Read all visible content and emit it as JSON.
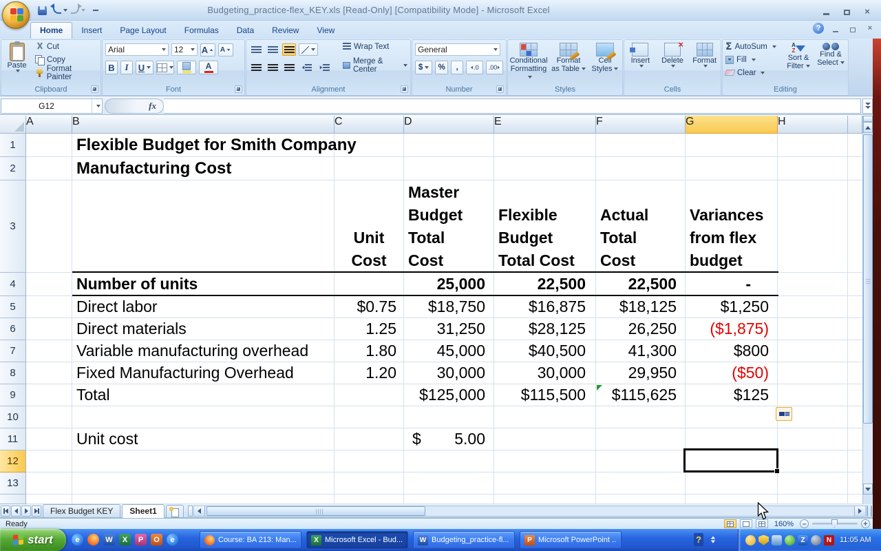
{
  "window": {
    "title": "Budgeting_practice-flex_KEY.xls  [Read-Only]  [Compatibility Mode] - Microsoft Excel",
    "close_glyph": "×",
    "help_glyph": "?"
  },
  "ribbon": {
    "tabs": [
      "Home",
      "Insert",
      "Page Layout",
      "Formulas",
      "Data",
      "Review",
      "View"
    ],
    "clipboard": {
      "label": "Clipboard",
      "paste": "Paste",
      "cut": "Cut",
      "copy": "Copy",
      "format_painter": "Format Painter"
    },
    "font": {
      "label": "Font",
      "family": "Arial",
      "size": "12",
      "bold": "B",
      "italic": "I",
      "underline": "U",
      "color_letter": "A",
      "grow_letter": "A",
      "shrink_letter": "A"
    },
    "alignment": {
      "label": "Alignment",
      "wrap_text": "Wrap Text",
      "merge_center": "Merge & Center"
    },
    "number": {
      "label": "Number",
      "format": "General",
      "currency": "$",
      "percent": "%",
      "comma": ",",
      "inc_decimal": ".0",
      "dec_decimal": ".00"
    },
    "styles": {
      "label": "Styles",
      "conditional_1": "Conditional",
      "conditional_2": "Formatting",
      "table_1": "Format",
      "table_2": "as Table",
      "cellstyles_1": "Cell",
      "cellstyles_2": "Styles"
    },
    "cells": {
      "label": "Cells",
      "insert": "Insert",
      "delete": "Delete",
      "format": "Format"
    },
    "editing": {
      "label": "Editing",
      "sigma": "Σ",
      "autosum": "AutoSum",
      "fill": "Fill",
      "clear": "Clear",
      "sort_1": "Sort &",
      "sort_2": "Filter",
      "find_1": "Find &",
      "find_2": "Select",
      "a": "A",
      "z": "Z"
    }
  },
  "formula_bar": {
    "cell_ref": "G12",
    "fx": "fx",
    "formula": ""
  },
  "sheet": {
    "columns": [
      "A",
      "B",
      "C",
      "D",
      "E",
      "F",
      "G",
      "H"
    ],
    "rows": [
      "1",
      "2",
      "3",
      "4",
      "5",
      "6",
      "7",
      "8",
      "9",
      "10",
      "11",
      "12",
      "13"
    ],
    "title1": "Flexible Budget for Smith Company",
    "title2": "Manufacturing Cost",
    "headers": {
      "c": "Unit\nCost",
      "d": "Master\nBudget\nTotal\nCost",
      "e": "Flexible\nBudget\nTotal Cost",
      "f": "Actual\nTotal\nCost",
      "g": "Variances\nfrom flex\nbudget"
    },
    "units_row": {
      "label": "Number of units",
      "d": "25,000",
      "e": "22,500",
      "f": "22,500",
      "g": "-"
    },
    "data_rows": [
      {
        "label": "Direct labor",
        "c": "$0.75",
        "d": "$18,750",
        "e": "$16,875",
        "f": "$18,125",
        "g": "$1,250"
      },
      {
        "label": "Direct materials",
        "c": "1.25",
        "d": "31,250",
        "e": "$28,125",
        "f": "26,250",
        "g": "($1,875)"
      },
      {
        "label": "Variable manufacturing overhead",
        "c": "1.80",
        "d": "45,000",
        "e": "$40,500",
        "f": "41,300",
        "g": "$800"
      },
      {
        "label": "Fixed Manufacturing Overhead",
        "c": "1.20",
        "d": "30,000",
        "e": "30,000",
        "f": "29,950",
        "g": "($50)"
      },
      {
        "label": "Total",
        "c": "",
        "d": "$125,000",
        "e": "$115,500",
        "f": "$115,625",
        "g": "$125"
      }
    ],
    "unit_cost_row": {
      "label": "Unit cost",
      "currency": "$",
      "value": "5.00"
    }
  },
  "sheet_tabs": {
    "tab1": "Flex Budget KEY",
    "tab2": "Sheet1"
  },
  "status_bar": {
    "mode": "Ready",
    "zoom": "160%"
  },
  "taskbar": {
    "start": "start",
    "quicklaunch_glyphs": [
      "e",
      "",
      "W",
      "X",
      "P",
      "O",
      "e"
    ],
    "tasks": [
      "Course: BA 213: Man...",
      "Microsoft Excel - Bud...",
      "Budgeting_practice-fl...",
      "Microsoft PowerPoint ..."
    ],
    "task_icon_glyphs": [
      "",
      "X",
      "W",
      "P"
    ],
    "help_glyph": "?",
    "tray_z": "Z",
    "tray_n": "N",
    "clock": "11:05 AM"
  },
  "colors": {
    "selection_header": "#F9CA52",
    "negative_number": "#E60000",
    "gridline": "#D5E0ED",
    "taskbar_blue": "#2765E0",
    "start_green": "#57AB35",
    "desktop_strip": "#46100A"
  }
}
